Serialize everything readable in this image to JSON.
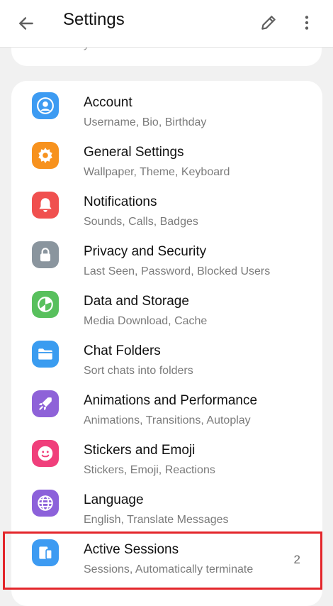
{
  "header": {
    "title": "Settings",
    "back_icon": "arrow-left-icon",
    "edit_icon": "pencil-icon",
    "more_icon": "more-vertical-icon"
  },
  "top_card": {
    "peek_text": "y"
  },
  "items": [
    {
      "label": "Account",
      "sub": "Username, Bio, Birthday",
      "color": "#3d9bf2",
      "icon": "person-icon",
      "badge": ""
    },
    {
      "label": "General Settings",
      "sub": "Wallpaper, Theme, Keyboard",
      "color": "#f7921e",
      "icon": "gear-icon",
      "badge": ""
    },
    {
      "label": "Notifications",
      "sub": "Sounds, Calls, Badges",
      "color": "#f0504f",
      "icon": "bell-icon",
      "badge": ""
    },
    {
      "label": "Privacy and Security",
      "sub": "Last Seen, Password, Blocked Users",
      "color": "#8a959e",
      "icon": "lock-icon",
      "badge": ""
    },
    {
      "label": "Data and Storage",
      "sub": "Media Download, Cache",
      "color": "#58c05d",
      "icon": "pie-chart-icon",
      "badge": ""
    },
    {
      "label": "Chat Folders",
      "sub": "Sort chats into folders",
      "color": "#3a9cf0",
      "icon": "folder-icon",
      "badge": ""
    },
    {
      "label": "Animations and Performance",
      "sub": "Animations, Transitions, Autoplay",
      "color": "#8e62d8",
      "icon": "rocket-icon",
      "badge": ""
    },
    {
      "label": "Stickers and Emoji",
      "sub": "Stickers, Emoji, Reactions",
      "color": "#f03f7b",
      "icon": "smile-icon",
      "badge": ""
    },
    {
      "label": "Language",
      "sub": "English, Translate Messages",
      "color": "#8c61da",
      "icon": "globe-icon",
      "badge": ""
    },
    {
      "label": "Active Sessions",
      "sub": "Sessions, Automatically terminate",
      "color": "#3d9bf2",
      "icon": "devices-icon",
      "badge": "2"
    }
  ],
  "colors": {
    "highlight": "#e3262b",
    "background": "#f1f1f1"
  }
}
